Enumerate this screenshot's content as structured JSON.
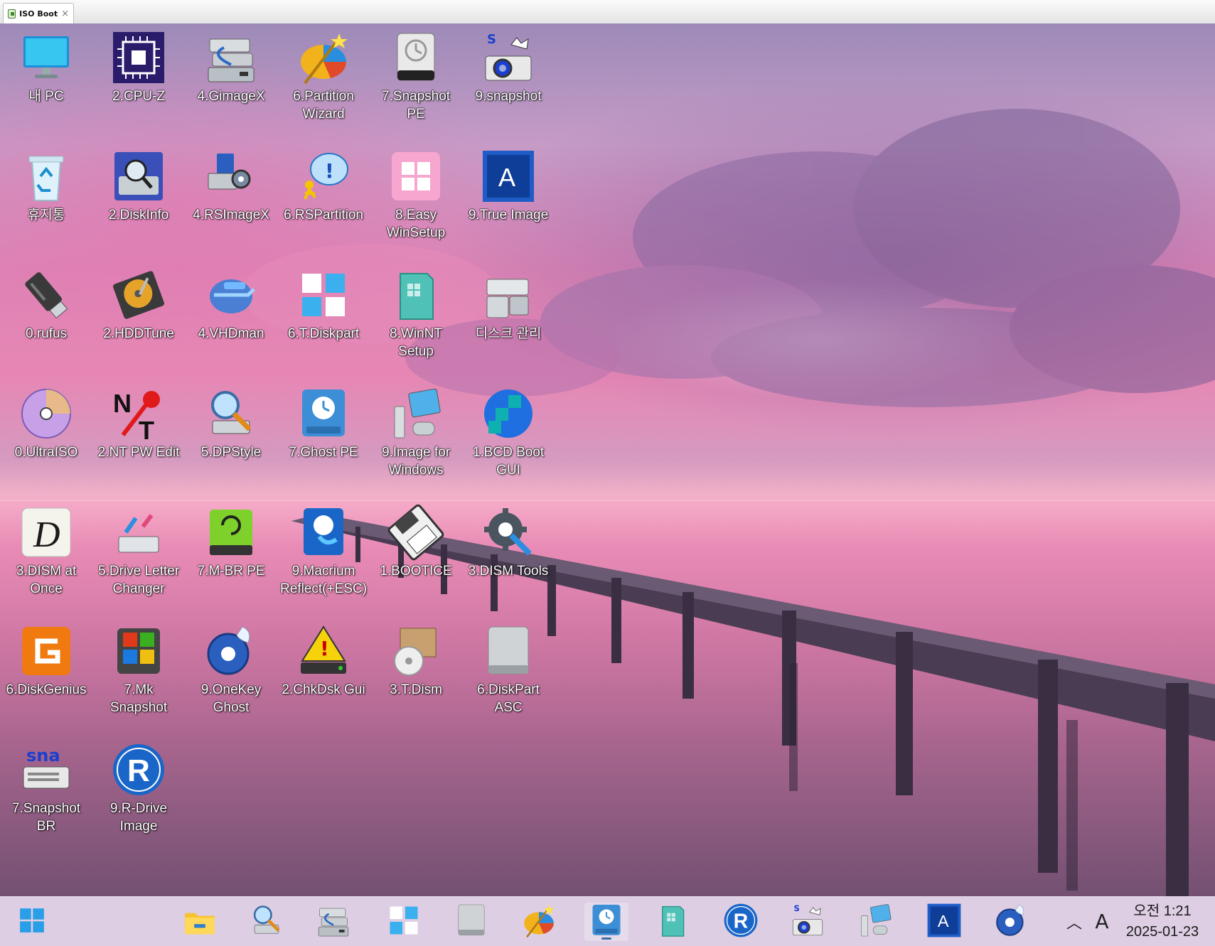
{
  "window": {
    "tab_title": "ISO Boot"
  },
  "desktop_icons": [
    {
      "label": "내 PC",
      "icon": "monitor-icon"
    },
    {
      "label": "2.CPU-Z",
      "icon": "cpu-chip-icon"
    },
    {
      "label": "4.GimageX",
      "icon": "drive-stack-icon"
    },
    {
      "label": "6.Partition Wizard",
      "icon": "partition-wizard-icon"
    },
    {
      "label": "7.Snapshot PE",
      "icon": "backup-drive-icon"
    },
    {
      "label": "9.snapshot",
      "icon": "snapshot-camera-icon"
    },
    {
      "label": "휴지통",
      "icon": "recycle-bin-icon"
    },
    {
      "label": "2.DiskInfo",
      "icon": "disk-info-icon"
    },
    {
      "label": "4.RSImageX",
      "icon": "computer-gear-icon"
    },
    {
      "label": "6.RSPartition",
      "icon": "partition-help-icon"
    },
    {
      "label": "8.Easy WinSetup",
      "icon": "windows-logo-icon"
    },
    {
      "label": "9.True Image",
      "icon": "acronis-a-icon"
    },
    {
      "label": "0.rufus",
      "icon": "usb-drive-icon"
    },
    {
      "label": "2.HDDTune",
      "icon": "hard-disk-icon"
    },
    {
      "label": "4.VHDman",
      "icon": "virtual-disk-icon"
    },
    {
      "label": "6.T.Diskpart",
      "icon": "four-squares-icon"
    },
    {
      "label": "8.WinNT Setup",
      "icon": "winnt-setup-icon"
    },
    {
      "label": "디스크 관리",
      "icon": "disk-management-icon"
    },
    {
      "label": "0.UltraISO",
      "icon": "optical-disc-icon"
    },
    {
      "label": "2.NT PW Edit",
      "icon": "nt-key-icon"
    },
    {
      "label": "5.DPStyle",
      "icon": "magnifier-drive-icon"
    },
    {
      "label": "7.Ghost PE",
      "icon": "ghost-clock-drive-icon"
    },
    {
      "label": "9.Image for Windows",
      "icon": "image-for-windows-icon"
    },
    {
      "label": "1.BCD Boot GUI",
      "icon": "bcd-boot-icon"
    },
    {
      "label": "3.DISM at Once",
      "icon": "letter-d-icon"
    },
    {
      "label": "5.Drive Letter Changer",
      "icon": "drive-letter-icon"
    },
    {
      "label": "7.M-BR PE",
      "icon": "green-drive-icon"
    },
    {
      "label": "9.Macrium Reflect(+ESC)",
      "icon": "macrium-reflect-icon"
    },
    {
      "label": "1.BOOTICE",
      "icon": "floppy-disk-icon"
    },
    {
      "label": "3.DISM Tools",
      "icon": "gear-wrench-icon"
    },
    {
      "label": "6.DiskGenius",
      "icon": "diskgenius-icon"
    },
    {
      "label": "7.Mk Snapshot",
      "icon": "mk-snapshot-icon"
    },
    {
      "label": "9.OneKey Ghost",
      "icon": "onekey-ghost-icon"
    },
    {
      "label": "2.ChkDsk Gui",
      "icon": "warning-drive-icon"
    },
    {
      "label": "3.T.Dism",
      "icon": "box-disc-icon"
    },
    {
      "label": "6.DiskPart ASC",
      "icon": "silver-drive-icon"
    },
    {
      "label": "7.Snapshot BR",
      "icon": "sna-drive-icon"
    },
    {
      "label": "9.R-Drive Image",
      "icon": "r-drive-icon"
    }
  ],
  "taskbar": {
    "items": [
      {
        "icon": "start-windows-icon"
      },
      {
        "icon": "file-explorer-icon"
      },
      {
        "icon": "magnifier-drive-icon"
      },
      {
        "icon": "drive-stack-icon"
      },
      {
        "icon": "four-squares-icon"
      },
      {
        "icon": "silver-drive-icon"
      },
      {
        "icon": "partition-wizard-icon"
      },
      {
        "icon": "ghost-clock-drive-icon"
      },
      {
        "icon": "winnt-setup-icon"
      },
      {
        "icon": "r-drive-icon"
      },
      {
        "icon": "snapshot-camera-icon"
      },
      {
        "icon": "image-for-windows-icon"
      },
      {
        "icon": "acronis-a-icon"
      },
      {
        "icon": "onekey-ghost-icon"
      }
    ],
    "tray": {
      "ime": "A"
    },
    "clock": {
      "time": "오전 1:21",
      "date": "2025-01-23"
    }
  }
}
